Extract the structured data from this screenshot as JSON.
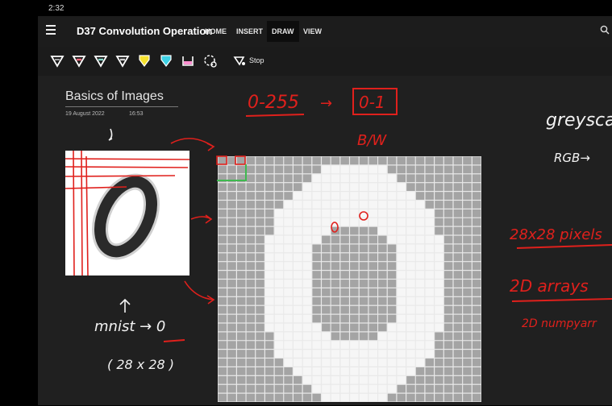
{
  "status": {
    "time": "2:32"
  },
  "app": {
    "title": "D37 Convolution Operation"
  },
  "ribbon": {
    "tabs": [
      {
        "label": "HOME"
      },
      {
        "label": "INSERT"
      },
      {
        "label": "DRAW",
        "active": true
      },
      {
        "label": "VIEW"
      }
    ]
  },
  "toolbar": {
    "pens": [
      {
        "name": "pen-white",
        "color": "#ffffff"
      },
      {
        "name": "pen-red",
        "color": "#ff6b7d"
      },
      {
        "name": "pen-teal",
        "color": "#7fd6c8"
      },
      {
        "name": "pen-light",
        "color": "#dddddd"
      },
      {
        "name": "highlighter-yellow",
        "color": "#f5e12e"
      },
      {
        "name": "highlighter-cyan",
        "color": "#3ed2e6"
      },
      {
        "name": "highlighter-pink",
        "color": "#ff8fd0"
      }
    ],
    "stop_label": "Stop"
  },
  "page": {
    "title": "Basics of Images",
    "date": "19 August 2022",
    "time": "16:53"
  },
  "ink_colors": {
    "red": "#e0201c",
    "white": "#f2f2f2",
    "green": "#3fb950"
  },
  "ink_notes": {
    "range_from": "0-255",
    "range_to": "0-1",
    "bw": "B/W",
    "greyscale": "greysca",
    "rgb": "RGB→",
    "size": "28x28 pixels",
    "arrays": "2D arrays",
    "numpy": "2D numpyarr",
    "mnist": "mnist → 0",
    "mnist_dims": "( 28 x 28 )"
  }
}
